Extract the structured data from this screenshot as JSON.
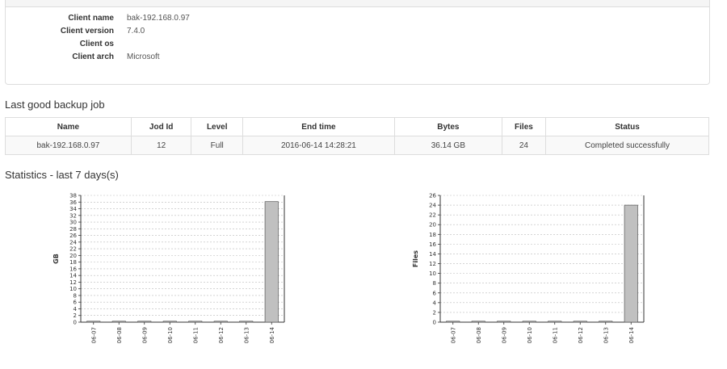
{
  "client": {
    "fields": [
      {
        "label": "Client name",
        "value": "bak-192.168.0.97"
      },
      {
        "label": "Client version",
        "value": "7.4.0"
      },
      {
        "label": "Client os",
        "value": ""
      },
      {
        "label": "Client arch",
        "value": "Microsoft"
      }
    ]
  },
  "last_job": {
    "title": "Last good backup job",
    "headers": [
      "Name",
      "Jod Id",
      "Level",
      "End time",
      "Bytes",
      "Files",
      "Status"
    ],
    "row": [
      "bak-192.168.0.97",
      "12",
      "Full",
      "2016-06-14 14:28:21",
      "36.14 GB",
      "24",
      "Completed successfully"
    ]
  },
  "stats": {
    "title": "Statistics - last 7 days(s)"
  },
  "colors": {
    "bar": "#c0c0c0",
    "bar_stroke": "#555555",
    "grid": "#bbbbbb"
  },
  "chart_data": [
    {
      "type": "bar",
      "categories": [
        "06-07",
        "06-08",
        "06-09",
        "06-10",
        "06-11",
        "06-12",
        "06-13",
        "06-14"
      ],
      "values": [
        0,
        0,
        0,
        0,
        0,
        0,
        0,
        36.14
      ],
      "ylabel": "GB",
      "ylim": [
        0,
        38
      ],
      "yticks": [
        0,
        2,
        4,
        6,
        8,
        10,
        12,
        14,
        16,
        18,
        20,
        22,
        24,
        26,
        28,
        30,
        32,
        34,
        36,
        38
      ],
      "grid": true
    },
    {
      "type": "bar",
      "categories": [
        "06-07",
        "06-08",
        "06-09",
        "06-10",
        "06-11",
        "06-12",
        "06-13",
        "06-14"
      ],
      "values": [
        0,
        0,
        0,
        0,
        0,
        0,
        0,
        24
      ],
      "ylabel": "Files",
      "ylim": [
        0,
        26
      ],
      "yticks": [
        0,
        2,
        4,
        6,
        8,
        10,
        12,
        14,
        16,
        18,
        20,
        22,
        24,
        26
      ],
      "grid": true
    }
  ]
}
